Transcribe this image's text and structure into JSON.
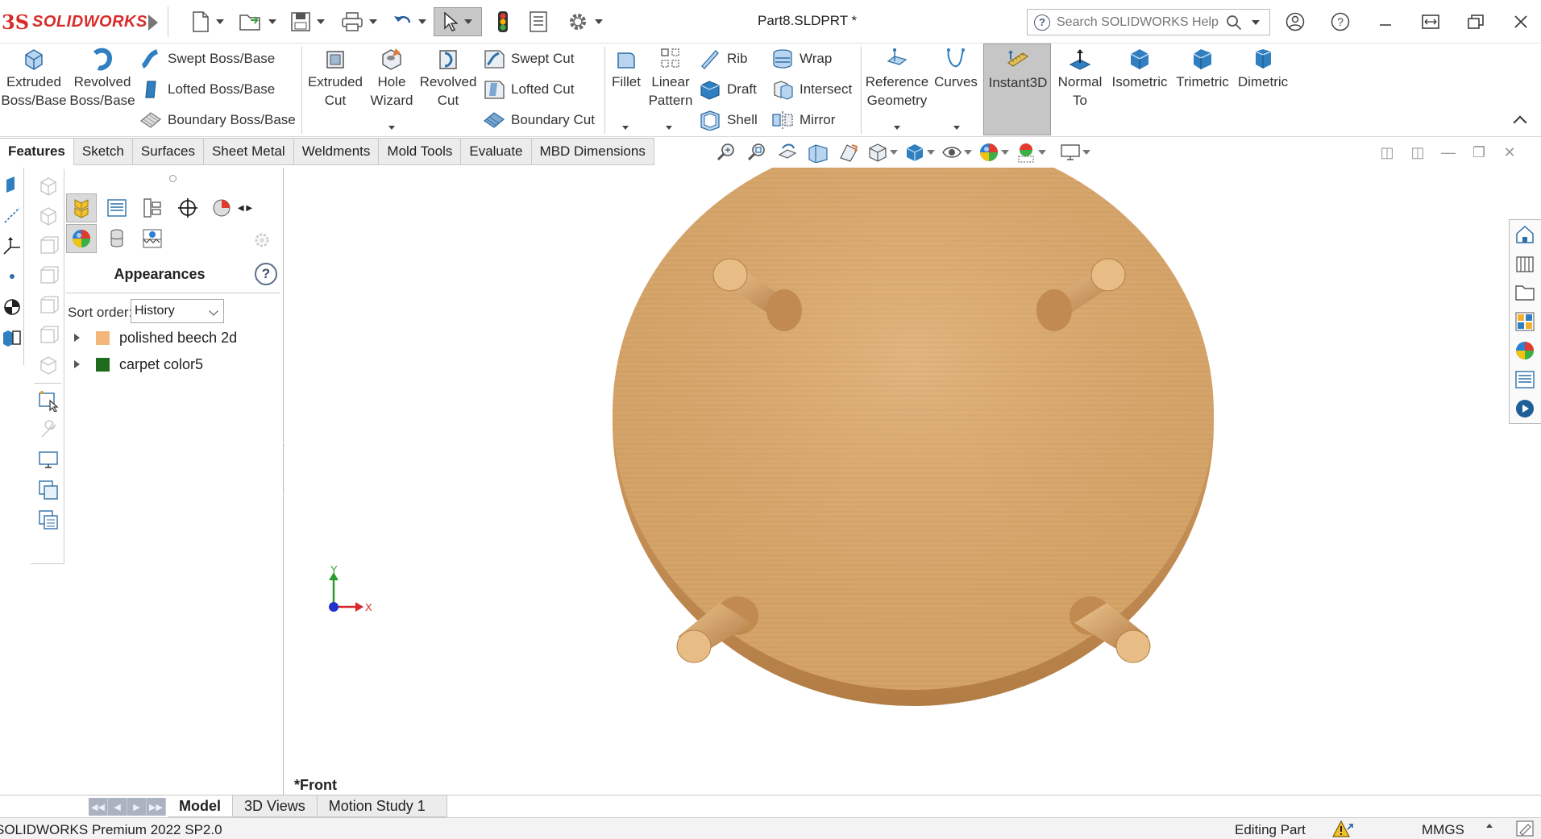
{
  "app": {
    "logo_ds": "3S",
    "logo_text": "SOLIDWORKS",
    "document_title": "Part8.SLDPRT *",
    "help_search_placeholder": "Search SOLIDWORKS Help"
  },
  "command_manager": {
    "features": {
      "extruded_boss": [
        "Extruded",
        "Boss/Base"
      ],
      "revolved_boss": [
        "Revolved",
        "Boss/Base"
      ],
      "swept_boss": "Swept Boss/Base",
      "lofted_boss": "Lofted Boss/Base",
      "boundary_boss": "Boundary Boss/Base",
      "extruded_cut": [
        "Extruded",
        "Cut"
      ],
      "hole_wizard": [
        "Hole",
        "Wizard"
      ],
      "revolved_cut": [
        "Revolved",
        "Cut"
      ],
      "swept_cut": "Swept Cut",
      "lofted_cut": "Lofted Cut",
      "boundary_cut": "Boundary Cut",
      "fillet": "Fillet",
      "linear_pattern": [
        "Linear",
        "Pattern"
      ],
      "rib": "Rib",
      "draft": "Draft",
      "shell": "Shell",
      "wrap": "Wrap",
      "intersect": "Intersect",
      "mirror": "Mirror",
      "reference_geometry": [
        "Reference",
        "Geometry"
      ],
      "curves": "Curves",
      "instant3d": "Instant3D",
      "normal_to": [
        "Normal",
        "To"
      ],
      "isometric": "Isometric",
      "trimetric": "Trimetric",
      "dimetric": "Dimetric"
    },
    "tabs": [
      "Features",
      "Sketch",
      "Surfaces",
      "Sheet Metal",
      "Weldments",
      "Mold Tools",
      "Evaluate",
      "MBD Dimensions"
    ],
    "active_tab": "Features"
  },
  "task_pane": {
    "title": "Appearances",
    "help": "?",
    "sort_label": "Sort order:",
    "sort_value": "History",
    "items": [
      {
        "label": "polished beech 2d",
        "swatch": "#f3b77a"
      },
      {
        "label": "carpet color5",
        "swatch": "#1e6b1e"
      }
    ]
  },
  "viewport": {
    "view_name": "*Front",
    "axis_x": "X",
    "axis_y": "Y",
    "model_color": "#d9a05e"
  },
  "bottom_tabs": [
    "Model",
    "3D Views",
    "Motion Study 1"
  ],
  "active_bottom_tab": "Model",
  "status_bar": {
    "product": "SOLIDWORKS Premium 2022 SP2.0",
    "mode": "Editing Part",
    "units": "MMGS"
  },
  "colors": {
    "brand": "#d72c2a",
    "instant3d_active": "#c6c6c6",
    "icon_blue": "#2f7fc1"
  }
}
